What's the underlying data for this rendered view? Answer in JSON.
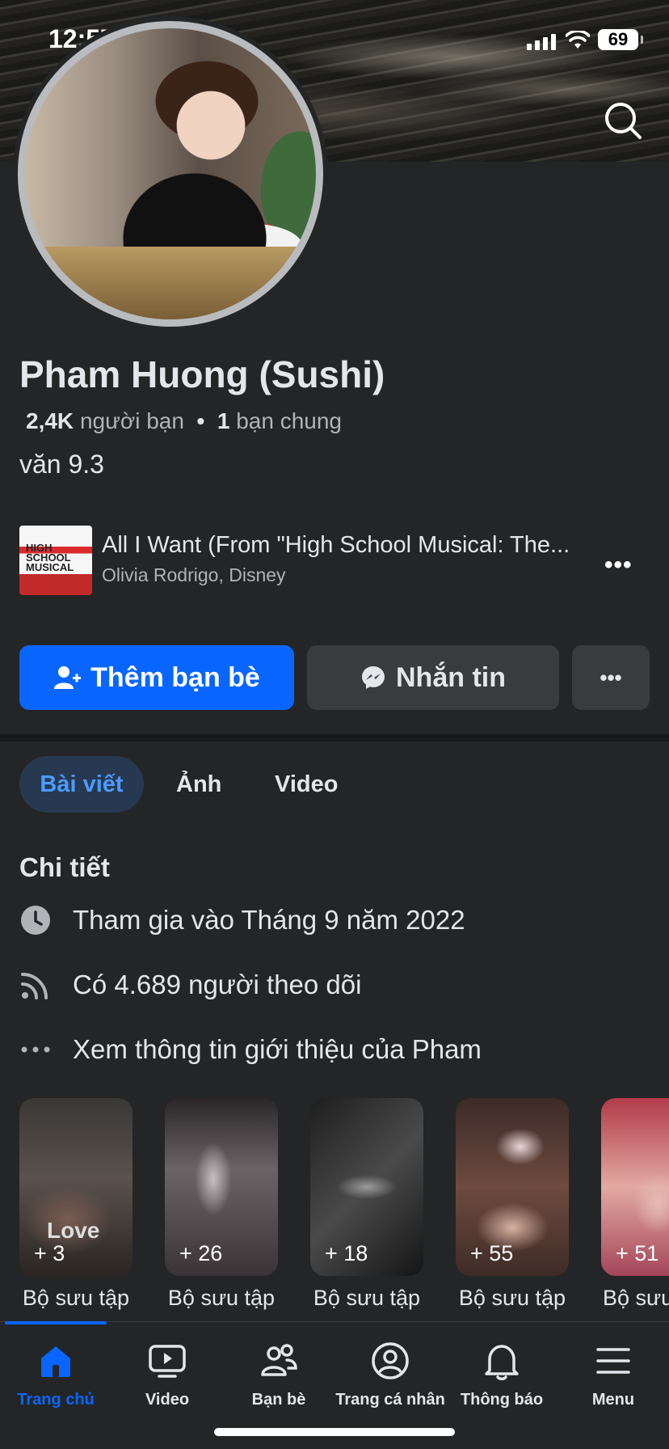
{
  "status_bar": {
    "time": "12:57",
    "battery": "69"
  },
  "profile": {
    "name": "Pham Huong (Sushi)",
    "friends_count": "2,4K",
    "friends_label": "người bạn",
    "separator": "•",
    "mutual_count": "1",
    "mutual_label": "bạn chung",
    "bio": "văn 9.3"
  },
  "music": {
    "title": "All I Want (From \"High School Musical: The...",
    "artist": "Olivia Rodrigo, Disney",
    "thumb_text": "HIGH SCHOOL MUSICAL"
  },
  "actions": {
    "add_friend": "Thêm bạn bè",
    "message": "Nhắn tin",
    "more": "•••"
  },
  "tabs": {
    "posts": "Bài viết",
    "photos": "Ảnh",
    "video": "Video"
  },
  "details": {
    "title": "Chi tiết",
    "joined": "Tham gia vào Tháng 9 năm 2022",
    "followers": "Có 4.689 người theo dõi",
    "about": "Xem thông tin giới thiệu của Pham"
  },
  "collections": [
    {
      "count": "+ 3",
      "label": "Bộ sưu tập",
      "overlay": "Love"
    },
    {
      "count": "+ 26",
      "label": "Bộ sưu tập"
    },
    {
      "count": "+ 18",
      "label": "Bộ sưu tập"
    },
    {
      "count": "+ 55",
      "label": "Bộ sưu tập"
    },
    {
      "count": "+ 51",
      "label": "Bộ sưu"
    }
  ],
  "bottom_nav": {
    "home": "Trang chủ",
    "video": "Video",
    "friends": "Bạn bè",
    "profile": "Trang cá nhân",
    "notifications": "Thông báo",
    "menu": "Menu"
  },
  "colors": {
    "accent": "#0866ff",
    "background": "#242526",
    "secondary_button": "#3a3b3c"
  }
}
